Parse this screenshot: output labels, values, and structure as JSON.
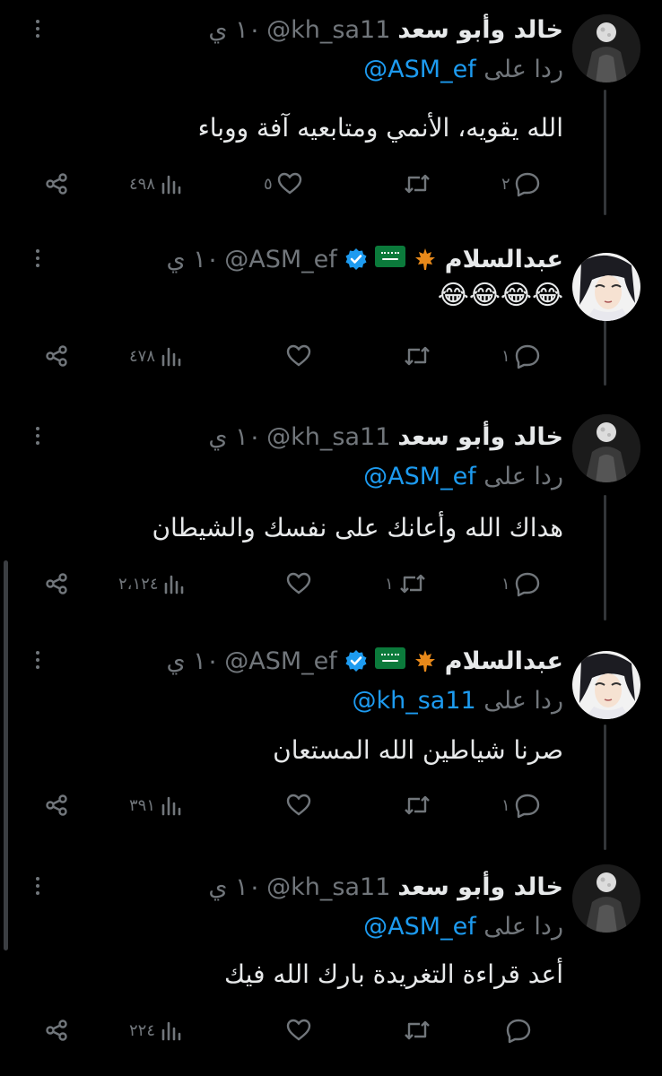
{
  "tweets": [
    {
      "author": "خالد وأبو سعد",
      "handle": "@kh_sa11",
      "time": "١٠ ي",
      "reply_prefix": "ردا على",
      "reply_mention": "@ASM_ef",
      "text": "الله يقويه، الأنمي ومتابعيه آفة ووباء",
      "replies": "٢",
      "retweets": "",
      "likes": "٥",
      "views": "٤٩٨",
      "avatar": "moon-mask-avatar"
    },
    {
      "author": "عبدالسلام",
      "handle": "@ASM_ef",
      "time": "١٠ ي",
      "text": "😂😂😂😂",
      "replies": "١",
      "retweets": "",
      "likes": "",
      "views": "٤٧٨",
      "avatar": "anime-character-avatar"
    },
    {
      "author": "خالد وأبو سعد",
      "handle": "@kh_sa11",
      "time": "١٠ ي",
      "reply_prefix": "ردا على",
      "reply_mention": "@ASM_ef",
      "text": "هداك الله وأعانك على نفسك والشيطان",
      "replies": "١",
      "retweets": "١",
      "likes": "",
      "views": "٢،١٢٤",
      "avatar": "moon-mask-avatar"
    },
    {
      "author": "عبدالسلام",
      "handle": "@ASM_ef",
      "time": "١٠ ي",
      "reply_prefix": "ردا على",
      "reply_mention": "@kh_sa11",
      "text": "صرنا شياطين الله المستعان",
      "replies": "١",
      "retweets": "",
      "likes": "",
      "views": "٣٩١",
      "avatar": "anime-character-avatar"
    },
    {
      "author": "خالد وأبو سعد",
      "handle": "@kh_sa11",
      "time": "١٠ ي",
      "reply_prefix": "ردا على",
      "reply_mention": "@ASM_ef",
      "text": "أعد قراءة التغريدة بارك الله فيك",
      "replies": "",
      "retweets": "",
      "likes": "",
      "views": "٢٢٤",
      "avatar": "moon-mask-avatar"
    }
  ],
  "time_separator": "·",
  "colors": {
    "background": "#000000",
    "text": "#e7e9ea",
    "muted": "#71767b",
    "link": "#1d9bf0",
    "verified": "#1d9bf0",
    "thread_line": "#333639"
  },
  "icons": [
    "more-icon",
    "reply-icon",
    "retweet-icon",
    "like-icon",
    "views-icon",
    "share-icon",
    "verified-badge-icon",
    "maple-leaf-icon",
    "saudi-flag-icon"
  ]
}
